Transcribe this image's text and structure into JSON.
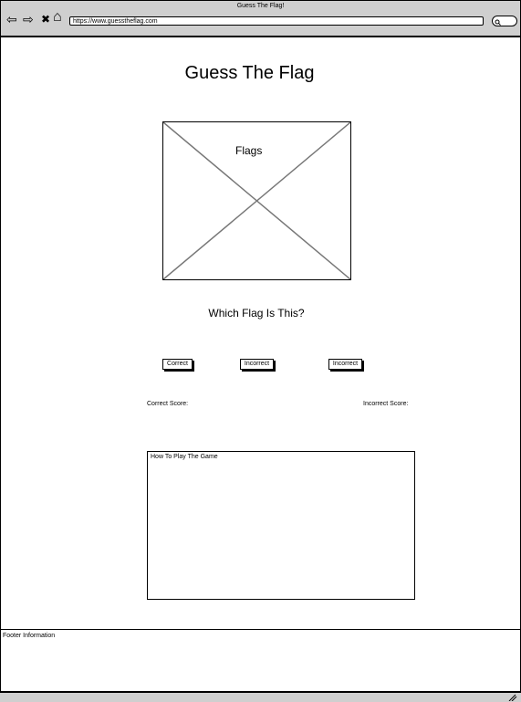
{
  "browser": {
    "window_title": "Guess The Flag!",
    "url": "https://www.guesstheflag.com",
    "nav_icons": [
      "back-arrow-icon",
      "forward-arrow-icon",
      "close-icon",
      "home-icon"
    ],
    "back_glyph": "⇦",
    "forward_glyph": "⇨",
    "close_glyph": "✖",
    "home_glyph": "⌂"
  },
  "page": {
    "title": "Guess The Flag",
    "flag_placeholder_label": "Flags",
    "question": "Which Flag Is This?",
    "answers": [
      "Correct",
      "Incorrect",
      "Incorrect"
    ],
    "correct_score_label": "Correct Score:",
    "incorrect_score_label": "Incorrect Score:",
    "how_to_title": "How To Play The Game",
    "footer": "Footer Information"
  }
}
